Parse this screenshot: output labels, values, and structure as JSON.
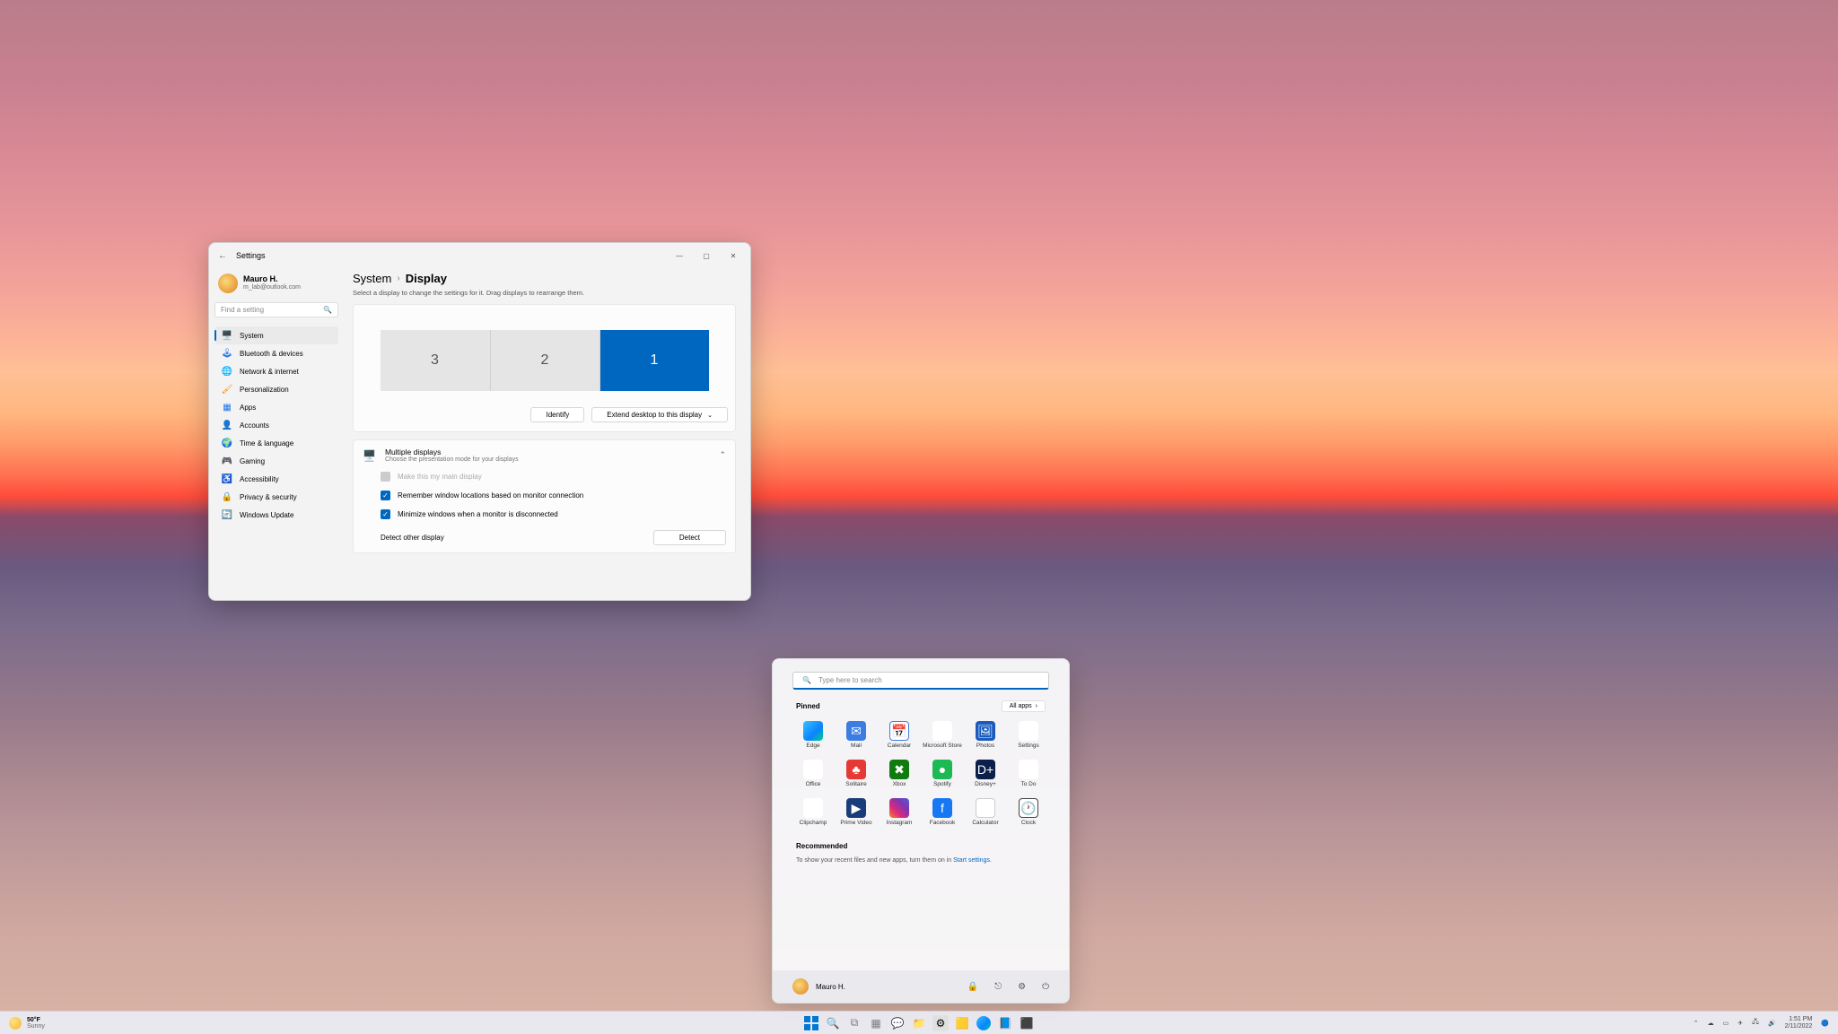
{
  "settings": {
    "app_title": "Settings",
    "user": {
      "name": "Mauro H.",
      "email": "m_lab@outlook.com"
    },
    "search_placeholder": "Find a setting",
    "nav": [
      {
        "label": "System",
        "icon": "🖥️",
        "active": true
      },
      {
        "label": "Bluetooth & devices",
        "icon": "🕹"
      },
      {
        "label": "Network & internet",
        "icon": "🌐"
      },
      {
        "label": "Personalization",
        "icon": "🖌"
      },
      {
        "label": "Apps",
        "icon": "▦"
      },
      {
        "label": "Accounts",
        "icon": "👤"
      },
      {
        "label": "Time & language",
        "icon": "🌍"
      },
      {
        "label": "Gaming",
        "icon": "🎮"
      },
      {
        "label": "Accessibility",
        "icon": "♿"
      },
      {
        "label": "Privacy & security",
        "icon": "🔒"
      },
      {
        "label": "Windows Update",
        "icon": "🔄"
      }
    ],
    "breadcrumb": {
      "parent": "System",
      "current": "Display"
    },
    "subtext": "Select a display to change the settings for it. Drag displays to rearrange them.",
    "monitors": [
      {
        "id": "3",
        "selected": false
      },
      {
        "id": "2",
        "selected": false
      },
      {
        "id": "1",
        "selected": true
      }
    ],
    "identify_btn": "Identify",
    "extend_btn": "Extend desktop to this display",
    "multi": {
      "title": "Multiple displays",
      "sub": "Choose the presentation mode for your displays"
    },
    "checks": {
      "main": {
        "label": "Make this my main display",
        "checked": false,
        "disabled": true
      },
      "remember": {
        "label": "Remember window locations based on monitor connection",
        "checked": true
      },
      "minimize": {
        "label": "Minimize windows when a monitor is disconnected",
        "checked": true
      }
    },
    "detect": {
      "label": "Detect other display",
      "btn": "Detect"
    }
  },
  "start": {
    "search_placeholder": "Type here to search",
    "pinned_label": "Pinned",
    "all_apps_label": "All apps",
    "apps": [
      {
        "name": "Edge"
      },
      {
        "name": "Mail"
      },
      {
        "name": "Calendar"
      },
      {
        "name": "Microsoft Store"
      },
      {
        "name": "Photos"
      },
      {
        "name": "Settings"
      },
      {
        "name": "Office"
      },
      {
        "name": "Solitaire"
      },
      {
        "name": "Xbox"
      },
      {
        "name": "Spotify"
      },
      {
        "name": "Disney+"
      },
      {
        "name": "To Do"
      },
      {
        "name": "Clipchamp"
      },
      {
        "name": "Prime Video"
      },
      {
        "name": "Instagram"
      },
      {
        "name": "Facebook"
      },
      {
        "name": "Calculator"
      },
      {
        "name": "Clock"
      }
    ],
    "recommended_label": "Recommended",
    "recommended_text": "To show your recent files and new apps, turn them on in ",
    "recommended_link": "Start settings",
    "user": "Mauro H."
  },
  "taskbar": {
    "weather": {
      "temp": "50°F",
      "cond": "Sunny"
    },
    "time": "1:51 PM",
    "date": "2/11/2022"
  }
}
